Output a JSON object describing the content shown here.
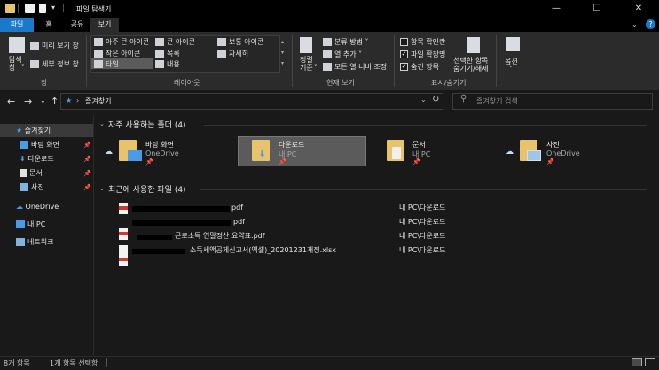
{
  "titlebar": {
    "title": "파일 탐색기",
    "separator": "|",
    "minimize": "—",
    "maximize": "☐",
    "close": "✕"
  },
  "tabs": {
    "file": "파일",
    "home": "홈",
    "share": "공유",
    "view": "보기",
    "collapse": "⌄",
    "help": "?"
  },
  "ribbon": {
    "pane": {
      "nav_pane_label": "탐색\n창",
      "nav_pane_arrow": "˅",
      "preview": "미리 보기 창",
      "details": "세부 정보 창",
      "group": "창"
    },
    "layout": {
      "items": [
        "아주 큰 아이콘",
        "큰 아이콘",
        "보통 아이콘",
        "작은 아이콘",
        "목록",
        "자세히",
        "타일",
        "내용"
      ],
      "group": "레이아웃"
    },
    "current_view": {
      "sort_label": "정렬\n기준",
      "sort_arrow": "˅",
      "group_by": "분류 방법",
      "add_column": "열 추가",
      "fit_columns": "모든 열 너비 조정",
      "group": "현재 보기"
    },
    "show_hide": {
      "item_checkboxes": "항목 확인란",
      "file_extensions": "파일 확장명",
      "hidden_items": "숨긴 항목",
      "hide_selected": "선택한 항목\n숨기기/해제",
      "group": "표시/숨기기"
    },
    "options": {
      "label": "옵션",
      "arrow": "˅"
    }
  },
  "address": {
    "back": "←",
    "forward": "→",
    "dropdown": "⌄",
    "up": "↑",
    "breadcrumb": "즐겨찾기",
    "chevron": "›",
    "history": "⌄",
    "refresh": "↻",
    "search_placeholder": "즐겨찾기 검색"
  },
  "nav": {
    "quick_access": "즐겨찾기",
    "items": [
      "바탕 화면",
      "다운로드",
      "문서",
      "사진"
    ],
    "onedrive": "OneDrive",
    "this_pc": "내 PC",
    "network": "네트워크"
  },
  "frequent": {
    "header": "자주 사용하는 폴더 (4)",
    "folders": [
      {
        "name": "바탕 화면",
        "sub": "OneDrive"
      },
      {
        "name": "다운로드",
        "sub": "내 PC"
      },
      {
        "name": "문서",
        "sub": "내 PC"
      },
      {
        "name": "사진",
        "sub": "OneDrive"
      }
    ]
  },
  "recent": {
    "header": "최근에 사용한 파일 (4)",
    "files": [
      {
        "name": "pdf",
        "location": "내 PC\\다운로드"
      },
      {
        "name": "pdf",
        "location": "내 PC\\다운로드"
      },
      {
        "name": "근로소득 연말정산 요약표.pdf",
        "location": "내 PC\\다운로드"
      },
      {
        "name": "소득세액공제신고서(엑셀)_20201231개정.xlsx",
        "location": "내 PC\\다운로드"
      }
    ]
  },
  "status": {
    "count": "8개 항목",
    "selected": "1개 항목 선택함"
  },
  "colors": {
    "accent": "#1979ca",
    "folder": "#e8c36b",
    "selected_tile": "#5b5b5b",
    "background": "#191919",
    "ribbon": "#2b2b2b"
  }
}
